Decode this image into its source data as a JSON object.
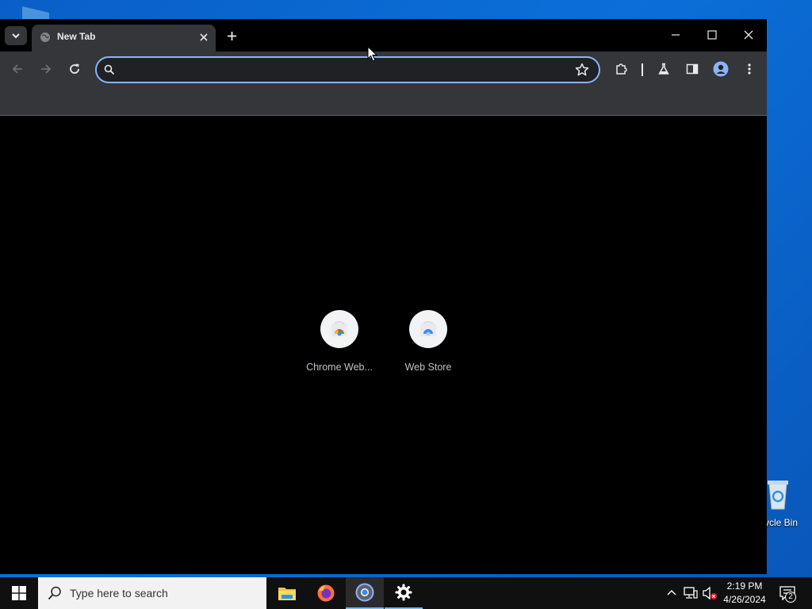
{
  "desktop": {
    "recycle_bin_label": "ycle Bin"
  },
  "browser": {
    "tab": {
      "title": "New Tab"
    },
    "omnibox": {
      "value": "",
      "placeholder": ""
    },
    "shortcuts": [
      {
        "label": "Chrome Web...",
        "icon": "chrome-web-store-icon"
      },
      {
        "label": "Web Store",
        "icon": "web-store-icon"
      }
    ],
    "accent_color": "#8ab4f8"
  },
  "taskbar": {
    "search_placeholder": "Type here to search",
    "apps": [
      {
        "name": "File Explorer",
        "icon": "folder-icon"
      },
      {
        "name": "Firefox",
        "icon": "firefox-icon"
      },
      {
        "name": "Chrome",
        "icon": "chrome-icon",
        "state": "active"
      },
      {
        "name": "Settings",
        "icon": "gear-icon"
      }
    ],
    "clock": {
      "time": "2:19 PM",
      "date": "4/26/2024"
    },
    "notification_count": "2"
  }
}
